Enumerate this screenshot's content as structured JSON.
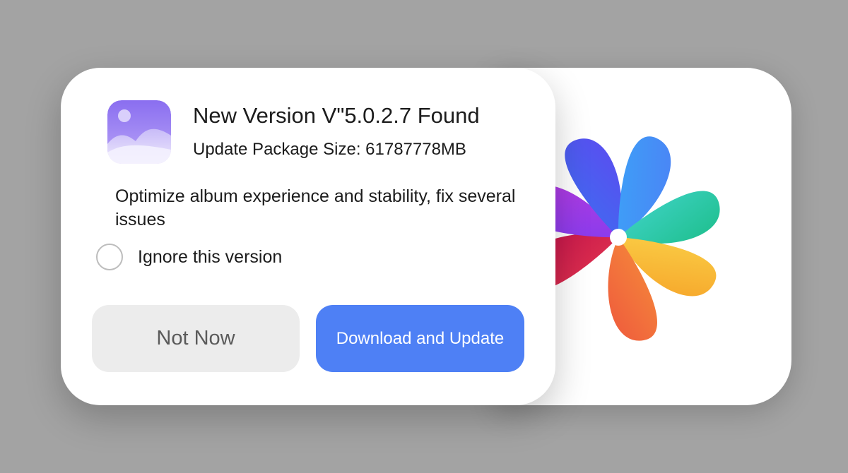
{
  "dialog": {
    "title": "New Version V\"5.0.2.7 Found",
    "package_size": "Update Package Size: 61787778MB",
    "description": "Optimize album experience and stability, fix several issues",
    "ignore_label": "Ignore this version",
    "ignore_checked": false,
    "secondary_button": "Not Now",
    "primary_button": "Download and Update"
  },
  "icons": {
    "app_icon": "gallery-photo-icon",
    "logo": "gallery-pinwheel-logo"
  },
  "colors": {
    "background": "#a3a3a3",
    "primary_button": "#4e80f5",
    "secondary_button": "#ececec"
  }
}
